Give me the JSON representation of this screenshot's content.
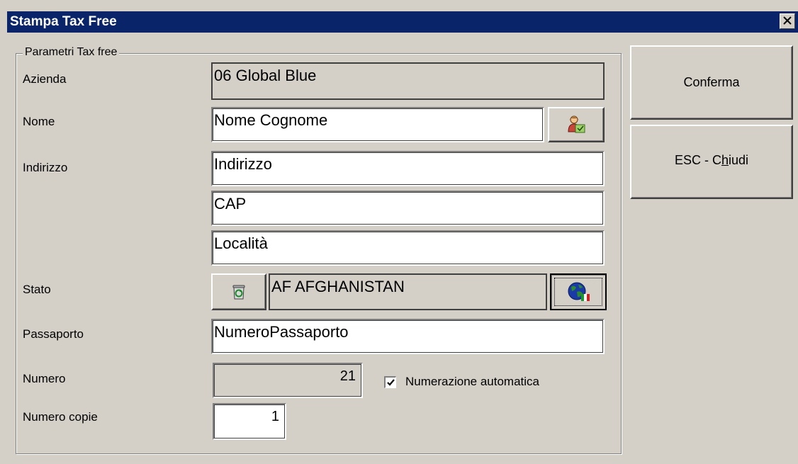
{
  "window": {
    "title": "Stampa Tax Free",
    "close_glyph": "✕"
  },
  "group": {
    "legend": "Parametri Tax free"
  },
  "fields": {
    "azienda": {
      "label": "Azienda",
      "value": "06 Global Blue"
    },
    "nome": {
      "label": "Nome",
      "value": "Nome Cognome",
      "button_icon": "client-lookup-icon"
    },
    "indirizzo": {
      "label": "Indirizzo",
      "value": "Indirizzo"
    },
    "cap": {
      "value": "CAP"
    },
    "localita": {
      "value": "Località"
    },
    "stato": {
      "label": "Stato",
      "value": "AF AFGHANISTAN",
      "clear_icon": "recycle-bin-icon",
      "lookup_icon": "globe-icon"
    },
    "passaporto": {
      "label": "Passaporto",
      "value": "NumeroPassaporto"
    },
    "numero": {
      "label": "Numero",
      "value": "21"
    },
    "auto_numbering": {
      "label": "Numerazione automatica",
      "checked": true
    },
    "copie": {
      "label": "Numero copie",
      "value": "1"
    }
  },
  "buttons": {
    "confirm": "Conferma",
    "close_prefix": "ESC - C",
    "close_underlined": "h",
    "close_suffix": "iudi"
  }
}
